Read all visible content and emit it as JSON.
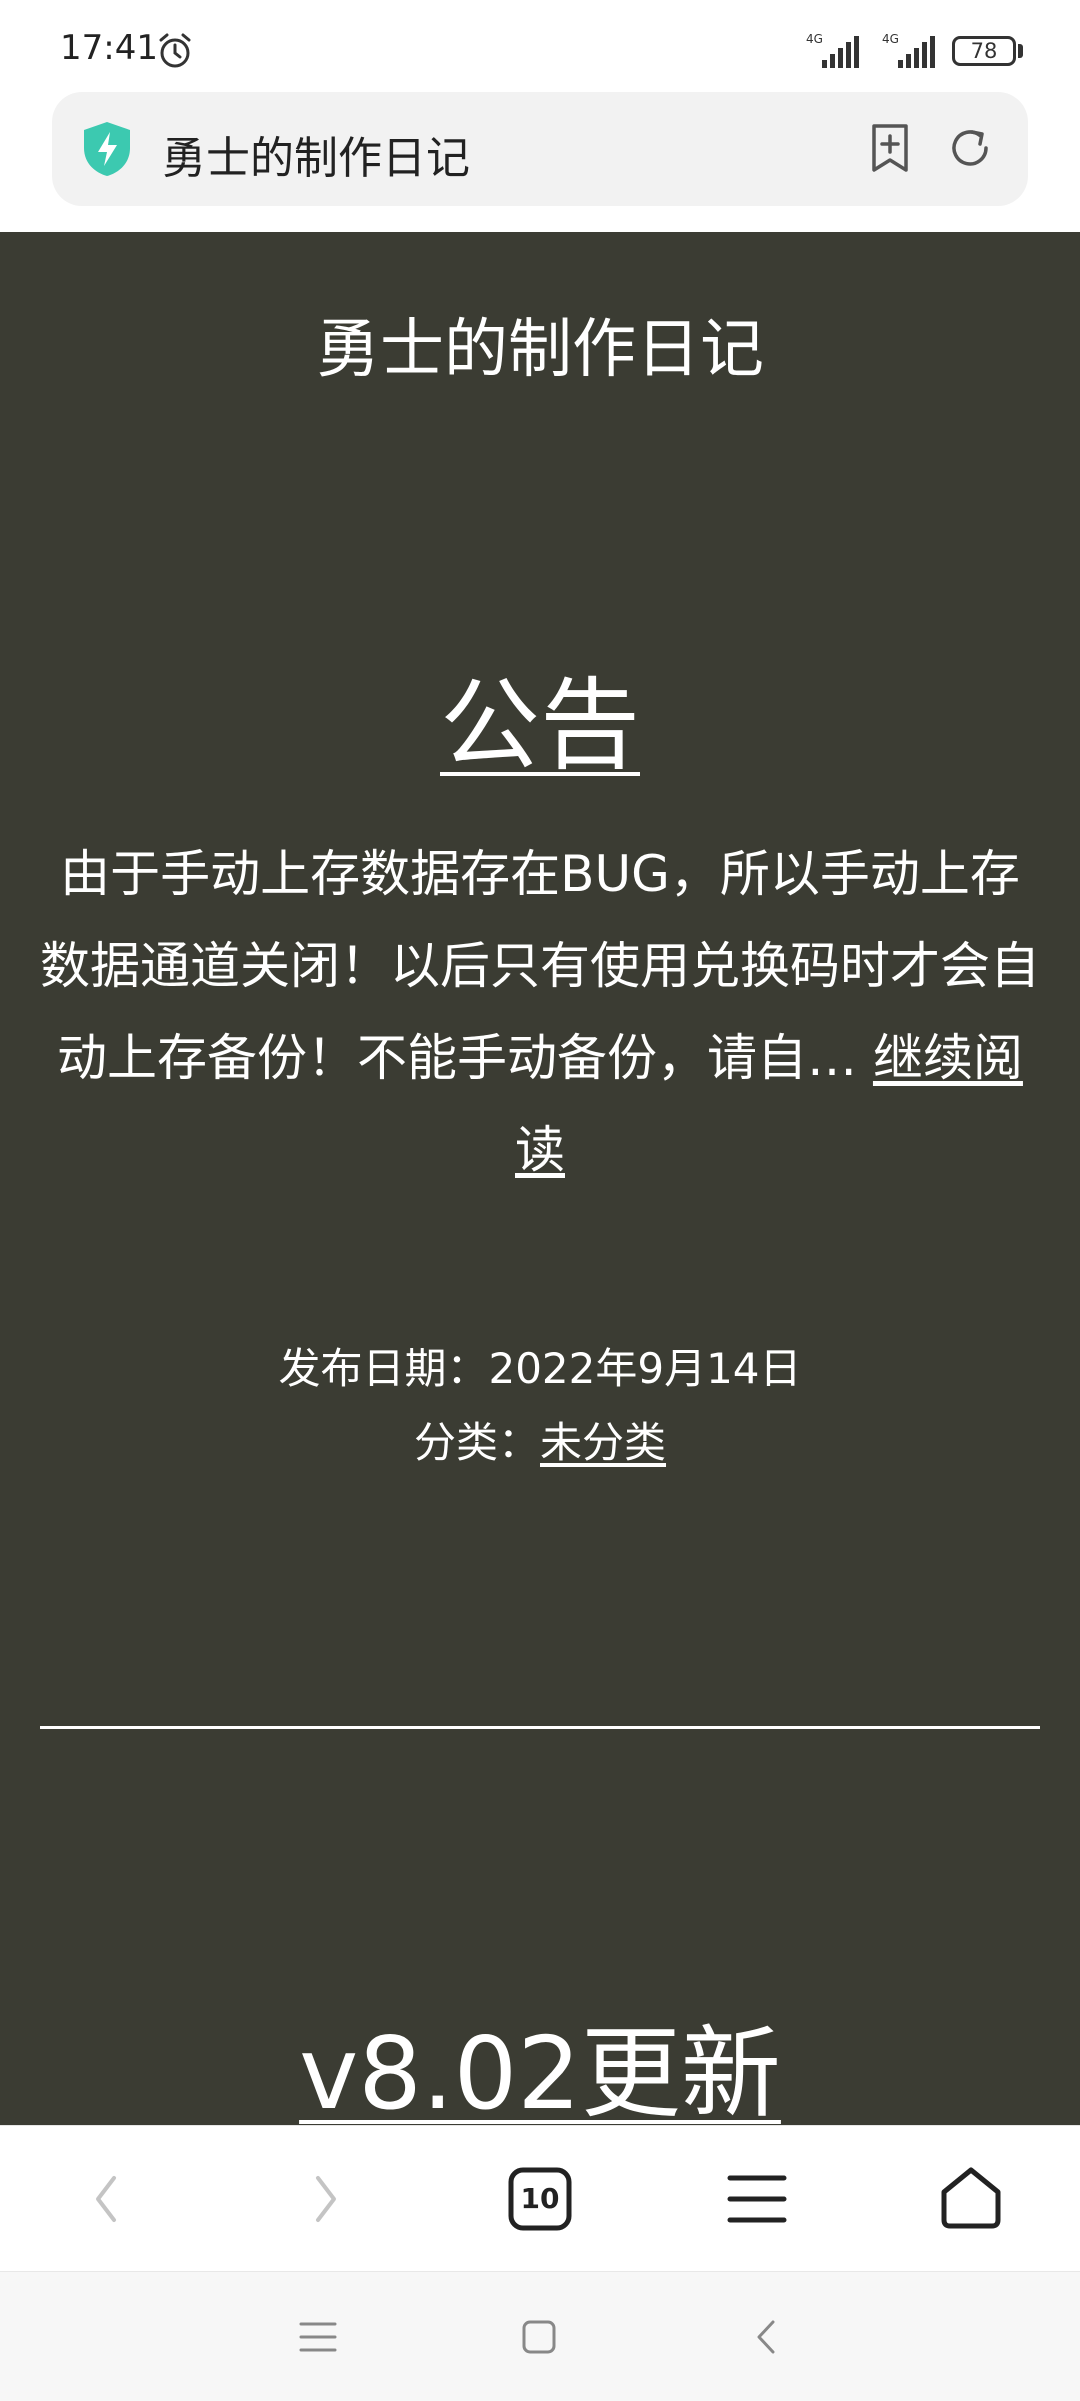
{
  "status_bar": {
    "time": "17:41",
    "signal1_label": "4G",
    "signal2_label": "4G",
    "battery": "78",
    "icons": [
      "alarm-icon",
      "signal-icon",
      "signal-icon",
      "battery-icon"
    ]
  },
  "address_bar": {
    "title": "勇士的制作日记",
    "icons": [
      "shield-icon",
      "bookmark-add-icon",
      "reload-icon"
    ],
    "accent_color": "#3cc9b0"
  },
  "page": {
    "background": "#3b3c33",
    "site_title": "勇士的制作日记",
    "posts": [
      {
        "title": "公告",
        "excerpt": "由于手动上存数据存在BUG，所以手动上存数据通道关闭！以后只有使用兑换码时才会自动上存备份！不能手动备份，请自… ",
        "read_more": "继续阅读",
        "date_label": "发布日期：",
        "date": "2022年9月14日",
        "category_label": "分类：",
        "category": "未分类"
      },
      {
        "title": "v8.02更新"
      }
    ]
  },
  "toolbar": {
    "tab_count": "10",
    "icons": [
      "back-icon",
      "forward-icon",
      "tabs-icon",
      "menu-icon",
      "home-icon"
    ]
  },
  "nav_bar": {
    "icons": [
      "recents-icon",
      "home-icon",
      "back-icon"
    ]
  }
}
